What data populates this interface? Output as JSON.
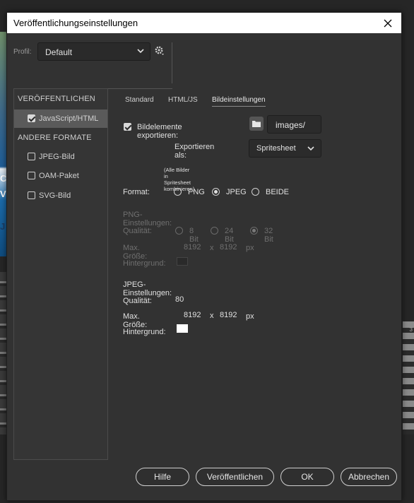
{
  "dialog": {
    "title": "Veröffentlichungseinstellungen"
  },
  "profile": {
    "label": "Profil:",
    "value": "Default"
  },
  "sidebar": {
    "publish_header": "VERÖFFENTLICHEN",
    "publish_items": [
      {
        "label": "JavaScript/HTML",
        "checked": true,
        "selected": true
      }
    ],
    "other_header": "ANDERE FORMATE",
    "other_items": [
      {
        "label": "JPEG-Bild",
        "checked": false
      },
      {
        "label": "OAM-Paket",
        "checked": false
      },
      {
        "label": "SVG-Bild",
        "checked": false
      }
    ]
  },
  "tabs": [
    {
      "label": "Standard",
      "active": false
    },
    {
      "label": "HTML/JS",
      "active": false
    },
    {
      "label": "Bildeinstellungen",
      "active": true
    }
  ],
  "image_settings": {
    "export_label": "Bildelemente exportieren:",
    "export_checked": true,
    "folder_value": "images/",
    "export_as_label": "Exportieren als:",
    "export_as_value": "Spritesheet",
    "export_as_note": "(Alle Bilder in Spritesheet kombinieren)",
    "format_label": "Format:",
    "format_options": [
      "PNG",
      "JPEG",
      "BEIDE"
    ],
    "format_selected": "JPEG",
    "png": {
      "header": "PNG-Einstellungen:",
      "quality_label": "Qualität:",
      "quality_options": [
        "8 Bit",
        "24 Bit",
        "32 Bit"
      ],
      "quality_selected": "32 Bit",
      "max_size_label": "Max. Größe:",
      "max_w": "8192",
      "x": "x",
      "max_h": "8192",
      "unit": "px",
      "background_label": "Hintergrund:",
      "background_color": "#2a2a2a"
    },
    "jpeg": {
      "header": "JPEG-Einstellungen:",
      "quality_label": "Qualität:",
      "quality_value": "80",
      "max_size_label": "Max. Größe:",
      "max_w": "8192",
      "x": "x",
      "max_h": "8192",
      "unit": "px",
      "background_label": "Hintergrund:",
      "background_color": "#ffffff"
    }
  },
  "footer": {
    "help": "Hilfe",
    "publish": "Veröffentlichen",
    "ok": "OK",
    "cancel": "Abbrechen"
  },
  "background": {
    "photo_text": [
      "C",
      "V",
      "J"
    ],
    "right_number": "3"
  },
  "colors": {
    "dialog_bg": "#323232",
    "titlebar_bg": "#ffffff",
    "selected_item": "#5a5a5a"
  }
}
